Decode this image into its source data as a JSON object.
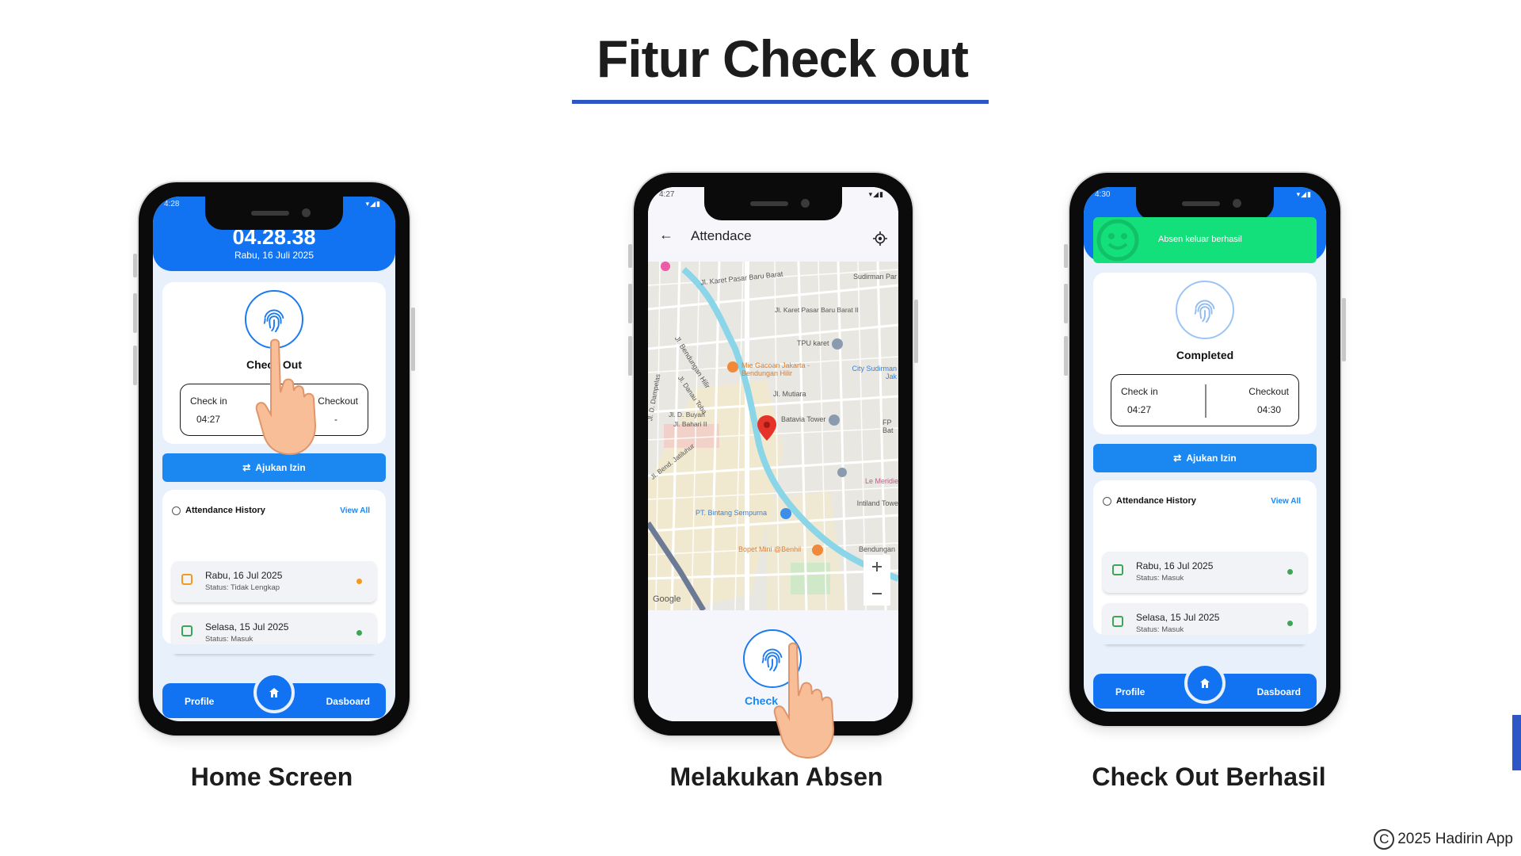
{
  "slide": {
    "title": "Fitur Check out",
    "footer": "2025 Hadirin App"
  },
  "captions": {
    "phone1": "Home Screen",
    "phone2": "Melakukan Absen",
    "phone3": "Check Out Berhasil"
  },
  "colors": {
    "accent": "#2f56c6",
    "app_blue": "#1273f2",
    "button_blue": "#1b87f0",
    "success_green": "#14e07b"
  },
  "phone1": {
    "status_time": "4:28",
    "clock": "04.28.38",
    "date": "Rabu, 16 Juli 2025",
    "check_label": "Check Out",
    "check_in_label": "Check in",
    "check_in_value": "04:27",
    "checkout_label": "Checkout",
    "checkout_value": "-",
    "ajukan_izin": "Ajukan Izin",
    "history_title": "Attendance History",
    "view_all": "View All",
    "history": [
      {
        "date": "Rabu, 16 Jul 2025",
        "status": "Status: Tidak Lengkap"
      },
      {
        "date": "Selasa, 15 Jul 2025",
        "status": "Status: Masuk"
      }
    ],
    "nav_profile": "Profile",
    "nav_dashboard": "Dasboard"
  },
  "phone2": {
    "status_time": "4:27",
    "title": "Attendace",
    "check_label": "Check",
    "map_labels": {
      "karet_pasar": "Jl. Karet Pasar Baru Barat",
      "karet_pasar2": "Jl. Karet Pasar Baru Barat II",
      "sudirman_park": "Sudirman Par",
      "bendungan_hilir": "Jl. Bendungan Hilir",
      "tpu_karet": "TPU karet",
      "mie_gacoan": "Mie Gacoan Jakarta - Bendungan Hilir",
      "city": "City Sudirman Jak",
      "danau_toba": "Jl. Danau Toba",
      "mutiara": "Jl. Mutiara",
      "buyan": "Jl. D. Buyan",
      "bahari": "Jl. Bahari II",
      "dampelas": "Jl. D. Dampelas",
      "batavia": "Batavia Tower",
      "fp": "FP Bat",
      "jatiluhur": "Jl. Bend. Jatiluhur",
      "le_meridien": "Le Meridie",
      "intiland": "Intiland Towe",
      "bintang": "PT. Bintang Sempurna",
      "bopet": "Bopet Mini @Benhil",
      "bendungan": "Bendungan",
      "google": "Google"
    }
  },
  "phone3": {
    "status_time": "4:30",
    "toast": "Absen keluar berhasil",
    "check_label": "Completed",
    "check_in_label": "Check in",
    "check_in_value": "04:27",
    "checkout_label": "Checkout",
    "checkout_value": "04:30",
    "ajukan_izin": "Ajukan Izin",
    "history_title": "Attendance History",
    "view_all": "View All",
    "history": [
      {
        "date": "Rabu, 16 Jul 2025",
        "status": "Status: Masuk"
      },
      {
        "date": "Selasa, 15 Jul 2025",
        "status": "Status: Masuk"
      }
    ],
    "nav_profile": "Profile",
    "nav_dashboard": "Dasboard"
  }
}
